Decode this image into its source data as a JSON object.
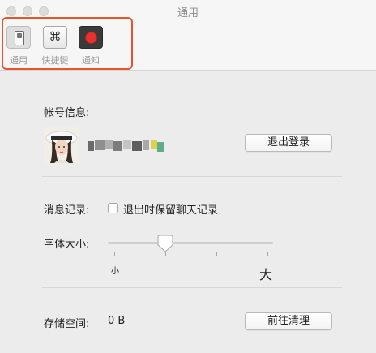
{
  "window": {
    "title": "通用"
  },
  "toolbar": {
    "items": [
      {
        "label": "通用",
        "icon": "switch-icon",
        "selected": true
      },
      {
        "label": "快捷键",
        "icon": "command-key-icon",
        "glyph": "⌘",
        "selected": false
      },
      {
        "label": "通知",
        "icon": "record-icon",
        "selected": false
      }
    ]
  },
  "account": {
    "heading": "帐号信息:",
    "logout_button": "退出登录"
  },
  "messages": {
    "heading": "消息记录:",
    "keep_history_label": "退出时保留聊天记录",
    "keep_history_checked": false
  },
  "font": {
    "heading": "字体大小:",
    "min_label": "小",
    "max_label": "大",
    "level": 1,
    "level_count": 4
  },
  "storage": {
    "heading": "存储空间:",
    "value": "0 B",
    "clear_button": "前往清理"
  },
  "colors": {
    "highlight": "#e8552c",
    "record_red": "#e5322d"
  }
}
